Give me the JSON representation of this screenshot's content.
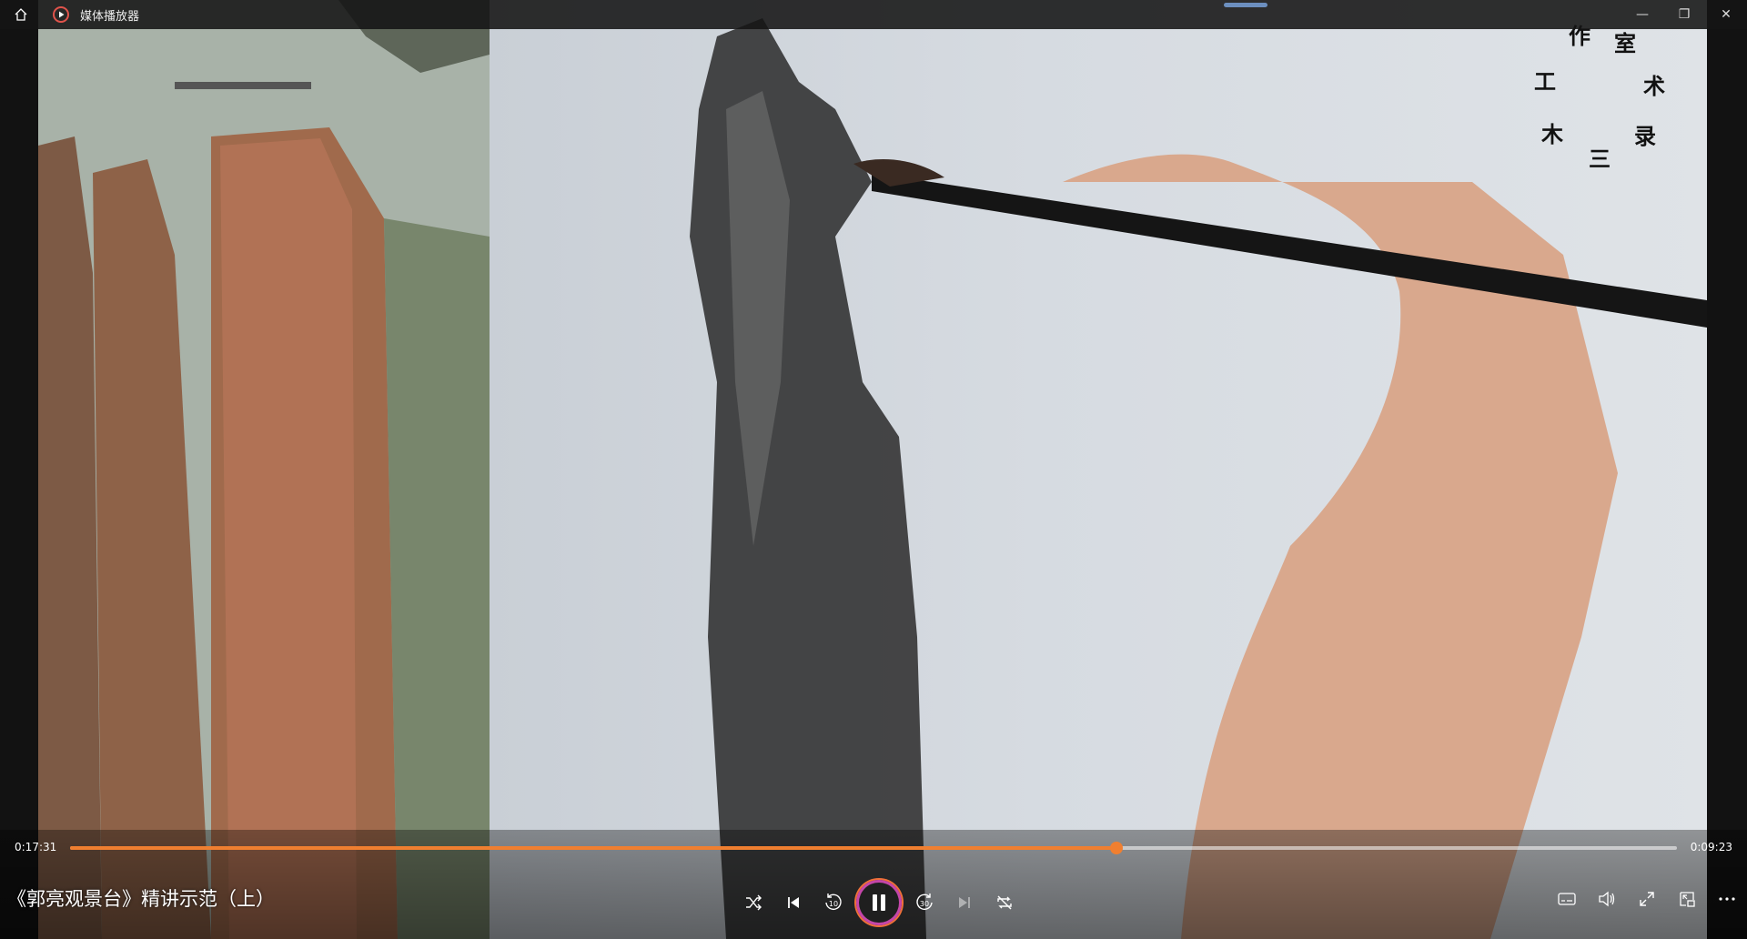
{
  "app": {
    "title": "媒体播放器"
  },
  "titlebar": {
    "icons": {
      "home": "home-icon",
      "app": "media-player-icon",
      "minimize": "minimize-icon",
      "restore": "restore-icon",
      "close": "close-icon"
    },
    "minimize_glyph": "—",
    "restore_glyph": "❐",
    "close_glyph": "✕"
  },
  "video": {
    "watermark_chars": [
      "工",
      "作",
      "室",
      "术",
      "录",
      "三",
      "木"
    ]
  },
  "player": {
    "elapsed": "0:17:31",
    "remaining": "0:09:23",
    "progress_fraction": 0.651,
    "accent_color": "#f07f30",
    "title": "《郭亮观景台》精讲示范（上）",
    "rewind_label": "10",
    "forward_label": "30",
    "state": "playing",
    "icons": {
      "shuffle": "shuffle-icon",
      "previous": "previous-icon",
      "rewind": "rewind-10-icon",
      "pause": "pause-icon",
      "forward": "forward-30-icon",
      "next": "next-icon",
      "repeat_off": "repeat-off-icon",
      "captions": "captions-icon",
      "volume": "volume-icon",
      "fullscreen": "fullscreen-icon",
      "mini_player": "mini-player-icon",
      "more": "more-icon"
    }
  }
}
